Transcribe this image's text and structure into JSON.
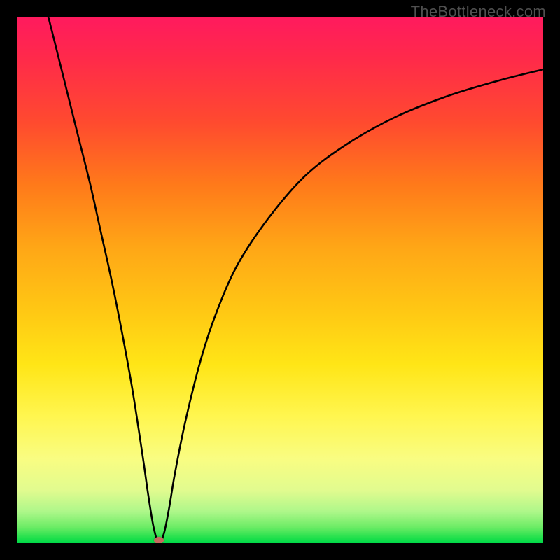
{
  "watermark": "TheBottleneck.com",
  "chart_data": {
    "type": "line",
    "title": "",
    "xlabel": "",
    "ylabel": "",
    "xlim": [
      0,
      100
    ],
    "ylim": [
      0,
      100
    ],
    "legend": false,
    "grid": false,
    "background_gradient": {
      "top": "#ff1a5e",
      "mid_upper": "#ff7a1a",
      "mid": "#ffe516",
      "bottom": "#00d948"
    },
    "series": [
      {
        "name": "bottleneck-curve",
        "description": "V-shaped curve: steep near-vertical left branch, rounded minimum near x≈27, rising concave right branch reaching top-right corner region.",
        "x": [
          6,
          8,
          10,
          12,
          14,
          16,
          18,
          20,
          22,
          24,
          25,
          26,
          27,
          28,
          29,
          30,
          32,
          35,
          38,
          42,
          48,
          55,
          63,
          72,
          82,
          92,
          100
        ],
        "values": [
          100,
          92,
          84,
          76,
          68,
          59,
          50,
          40,
          29,
          16,
          9,
          3,
          0,
          2,
          7,
          13,
          23,
          35,
          44,
          53,
          62,
          70,
          76,
          81,
          85,
          88,
          90
        ]
      }
    ],
    "minimum_point": {
      "x": 27,
      "y": 0
    },
    "minimum_marker_color": "#c76a5e"
  }
}
